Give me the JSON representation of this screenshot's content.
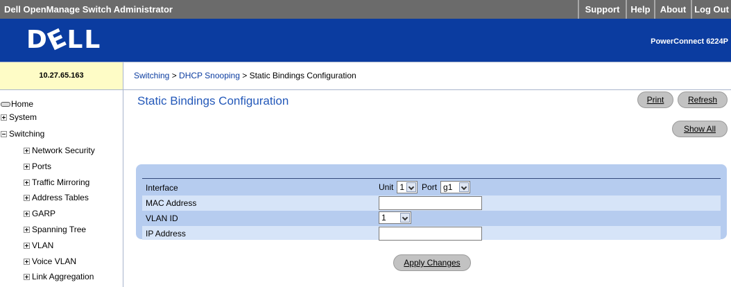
{
  "topbar": {
    "app_title": "Dell OpenManage Switch Administrator",
    "links": [
      "Support",
      "Help",
      "About",
      "Log Out"
    ]
  },
  "banner": {
    "logo": "DELL",
    "model": "PowerConnect 6224P"
  },
  "ip_address": "10.27.65.163",
  "breadcrumb": {
    "part1": "Switching",
    "sep1": " > ",
    "part2": "DHCP Snooping",
    "sep2": " > ",
    "current": "Static Bindings Configuration"
  },
  "sidebar": {
    "items": [
      {
        "label": "Home",
        "icon": "home-icon"
      },
      {
        "label": "System",
        "icon": "expand-icon"
      },
      {
        "label": "Switching",
        "icon": "collapse-icon"
      },
      {
        "label": "Network Security",
        "icon": "expand-icon"
      },
      {
        "label": "Ports",
        "icon": "expand-icon"
      },
      {
        "label": "Traffic Mirroring",
        "icon": "expand-icon"
      },
      {
        "label": "Address Tables",
        "icon": "expand-icon"
      },
      {
        "label": "GARP",
        "icon": "expand-icon"
      },
      {
        "label": "Spanning Tree",
        "icon": "expand-icon"
      },
      {
        "label": "VLAN",
        "icon": "expand-icon"
      },
      {
        "label": "Voice VLAN",
        "icon": "expand-icon"
      },
      {
        "label": "Link Aggregation",
        "icon": "expand-icon"
      }
    ]
  },
  "main": {
    "title": "Static Bindings Configuration",
    "buttons": {
      "print": "Print",
      "refresh": "Refresh",
      "show_all": "Show All",
      "apply": "Apply Changes"
    },
    "form": {
      "interface_label": "Interface",
      "unit_label": "Unit",
      "unit_value": "1",
      "port_label": "Port",
      "port_value": "g1",
      "mac_label": "MAC Address",
      "mac_value": "",
      "vlan_label": "VLAN ID",
      "vlan_value": "1",
      "ip_label": "IP Address",
      "ip_value": ""
    }
  },
  "colors": {
    "banner": "#0b3ca0",
    "topbar": "#6b6b6b",
    "title": "#2358b9",
    "panel": "#b6ccef",
    "ip_cell": "#fefcc6"
  }
}
